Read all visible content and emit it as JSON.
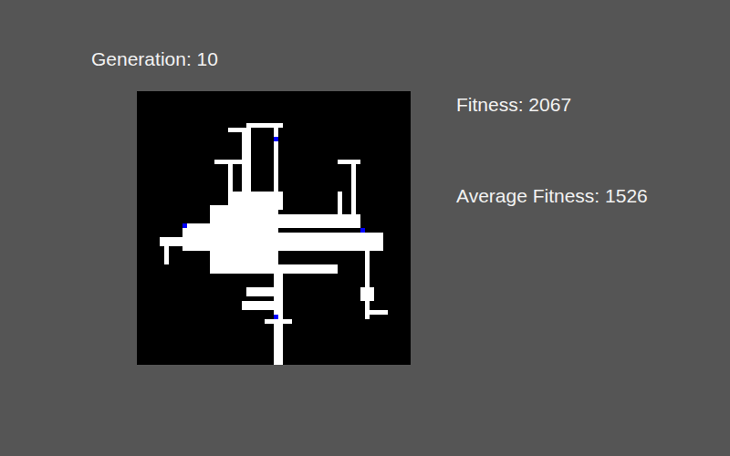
{
  "header": {
    "generation": "Generation: 10"
  },
  "stats": [
    {
      "label": "Fitness: 2067"
    },
    {
      "label": "Average Fitness: 1526"
    }
  ],
  "world": {
    "visited": [
      [
        16,
        25,
        15,
        15
      ],
      [
        10,
        29,
        8,
        6
      ],
      [
        5,
        32,
        8,
        2
      ],
      [
        6,
        32,
        1,
        6
      ],
      [
        20,
        22,
        12,
        4
      ],
      [
        24,
        7,
        8,
        1
      ],
      [
        24,
        7,
        1,
        16
      ],
      [
        30,
        7,
        1,
        16
      ],
      [
        20,
        8,
        5,
        1
      ],
      [
        23,
        8,
        1,
        14
      ],
      [
        17,
        15,
        7,
        1
      ],
      [
        20,
        15,
        1,
        11
      ],
      [
        47,
        15,
        1,
        15
      ],
      [
        44,
        15,
        5,
        1
      ],
      [
        44,
        22,
        1,
        8
      ],
      [
        31,
        27,
        18,
        3
      ],
      [
        31,
        31,
        23,
        4
      ],
      [
        31,
        38,
        13,
        2
      ],
      [
        50,
        31,
        1,
        19
      ],
      [
        50,
        48,
        5,
        1
      ],
      [
        49,
        43,
        3,
        3
      ],
      [
        30,
        40,
        2,
        20
      ],
      [
        23,
        46,
        9,
        2
      ],
      [
        24,
        43,
        7,
        2
      ],
      [
        28,
        50,
        6,
        1
      ]
    ],
    "agents": [
      {
        "x": 30,
        "y": 10
      },
      {
        "x": 10,
        "y": 29
      },
      {
        "x": 49,
        "y": 30
      },
      {
        "x": 30,
        "y": 49
      }
    ]
  }
}
